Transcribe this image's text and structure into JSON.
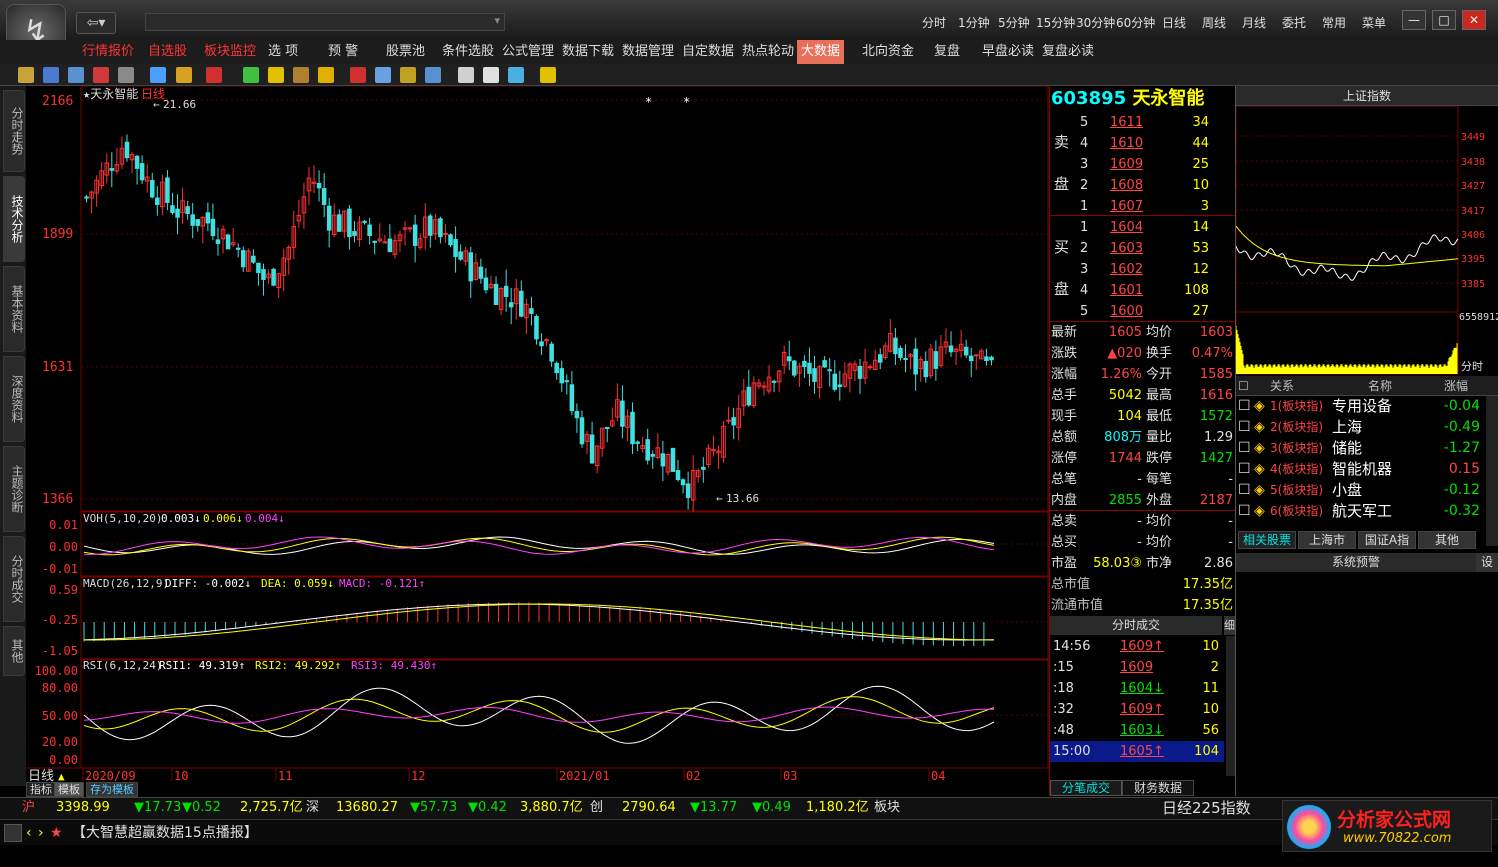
{
  "titlebar": {
    "periods": [
      "分时",
      "1分钟",
      "5分钟",
      "15分钟",
      "30分钟",
      "60分钟",
      "日线",
      "周线",
      "月线",
      "委托",
      "常用",
      "菜单"
    ]
  },
  "menu": {
    "items": [
      "行情报价",
      "自选股",
      "板块监控",
      "选 项",
      "预 警",
      "股票池",
      "条件选股",
      "公式管理",
      "数据下载",
      "数据管理",
      "自定数据",
      "热点轮动",
      "大数据",
      "北向资金",
      "复盘",
      "早盘必读",
      "复盘必读"
    ]
  },
  "left_tabs": [
    "分时走势",
    "技术分析",
    "基本资料",
    "深度资料",
    "主题诊断",
    "分时成交",
    "其他"
  ],
  "chart": {
    "name": "★天永智能",
    "period": "日线",
    "max_label": "21.66",
    "min_label": "13.66",
    "prices": [
      "2166",
      "1899",
      "1631",
      "1366"
    ],
    "vol_title": "VOH(5,10,20)",
    "vol_v1": "0.003↓",
    "vol_v2": "0.006↓",
    "vol_v3": "0.004↓",
    "vol_axis": [
      "0.01",
      "0.00",
      "-0.01"
    ],
    "macd_title": "MACD(26,12,9)",
    "diff": "DIFF: -0.002↓",
    "dea": "DEA: 0.059↓",
    "macd": "MACD: -0.121↑",
    "macd_axis": [
      "0.59",
      "-0.25",
      "-1.05"
    ],
    "rsi_title": "RSI(6,12,24)",
    "rsi1": "RSI1: 49.319↑",
    "rsi2": "RSI2: 49.292↑",
    "rsi3": "RSI3: 49.430↑",
    "rsi_axis": [
      "100.00",
      "80.00",
      "50.00",
      "20.00",
      "0.00"
    ],
    "dates": [
      "2020/09",
      "10",
      "11",
      "12",
      "2021/01",
      "02",
      "03",
      "04"
    ],
    "period_label": "日线",
    "tab_index": "指标",
    "tab_template": "模板",
    "tab_save": "存为模板"
  },
  "quote": {
    "code": "603895",
    "name": "天永智能",
    "sell_label_a": "卖",
    "sell_label_b": "盘",
    "buy_label_a": "买",
    "buy_label_b": "盘",
    "asks": [
      {
        "n": "5",
        "p": "1611",
        "v": "34"
      },
      {
        "n": "4",
        "p": "1610",
        "v": "44"
      },
      {
        "n": "3",
        "p": "1609",
        "v": "25"
      },
      {
        "n": "2",
        "p": "1608",
        "v": "10"
      },
      {
        "n": "1",
        "p": "1607",
        "v": "3"
      }
    ],
    "bids": [
      {
        "n": "1",
        "p": "1604",
        "v": "14"
      },
      {
        "n": "2",
        "p": "1603",
        "v": "53"
      },
      {
        "n": "3",
        "p": "1602",
        "v": "12"
      },
      {
        "n": "4",
        "p": "1601",
        "v": "108"
      },
      {
        "n": "5",
        "p": "1600",
        "v": "27"
      }
    ],
    "stats": [
      [
        "最新",
        "1605",
        "均价",
        "1603"
      ],
      [
        "涨跌",
        "▲020",
        "换手",
        "0.47%"
      ],
      [
        "涨幅",
        "1.26%",
        "今开",
        "1585"
      ],
      [
        "总手",
        "5042",
        "最高",
        "1616"
      ],
      [
        "现手",
        "104",
        "最低",
        "1572"
      ],
      [
        "总额",
        "808万",
        "量比",
        "1.29"
      ],
      [
        "涨停",
        "1744",
        "跌停",
        "1427"
      ],
      [
        "总笔",
        "-",
        "每笔",
        "-"
      ],
      [
        "内盘",
        "2855",
        "外盘",
        "2187"
      ],
      [
        "总卖",
        "-",
        "均价",
        "-"
      ],
      [
        "总买",
        "-",
        "均价",
        "-"
      ],
      [
        "市盈",
        "58.03③",
        "市净",
        "2.86"
      ]
    ],
    "mktcap_label": "总市值",
    "mktcap": "17.35亿",
    "float_label": "流通市值",
    "float": "17.35亿",
    "ticks_head": "分时成交",
    "ticks_btn": "细",
    "ticks": [
      [
        "14:56",
        "1609↑",
        "10"
      ],
      [
        ":15",
        "1609",
        "2"
      ],
      [
        ":18",
        "1604↓",
        "11"
      ],
      [
        ":32",
        "1609↑",
        "10"
      ],
      [
        ":48",
        "1603↓",
        "56"
      ],
      [
        "15:00",
        "1605↑",
        "104"
      ]
    ],
    "tab_deal": "分笔成交",
    "tab_fin": "财务数据"
  },
  "index_panel": {
    "title": "上证指数",
    "levels": [
      "3449",
      "3438",
      "3427",
      "3417",
      "3406",
      "3395",
      "3385"
    ],
    "vol_label": "6558912",
    "fenshi": "分时"
  },
  "related": {
    "head_rel": "关系",
    "head_name": "名称",
    "head_chg": "涨幅",
    "rows": [
      [
        "1(板块指)",
        "专用设备",
        "-0.04"
      ],
      [
        "2(板块指)",
        "上海",
        "-0.49"
      ],
      [
        "3(板块指)",
        "储能",
        "-1.27"
      ],
      [
        "4(板块指)",
        "智能机器",
        "0.15"
      ],
      [
        "5(板块指)",
        "小盘",
        "-0.12"
      ],
      [
        "6(板块指)",
        "航天军工",
        "-0.32"
      ]
    ],
    "tabs": [
      "相关股票",
      "上海市",
      "国证A指",
      "其他"
    ],
    "warn": "系统预警",
    "warn_btn": "设"
  },
  "status": {
    "sh": "沪",
    "sh_idx": "3398.99",
    "sh_chg": "▼17.73",
    "sh_pct": "▼0.52",
    "sh_amt": "2,725.7亿",
    "sz": "深",
    "sz_idx": "13680.27",
    "sz_chg": "▼57.73",
    "sz_pct": "▼0.42",
    "sz_amt": "3,880.7亿",
    "cy": "创",
    "cy_idx": "2790.64",
    "cy_chg": "▼13.77",
    "cy_pct": "▼0.49",
    "cy_amt": "1,180.2亿",
    "bk": "板块",
    "nikkei": "日经225指数"
  },
  "ticker": {
    "text": "【大智慧超赢数据15点播报】"
  },
  "watermark": {
    "title": "分析家公式网",
    "url": "www.70822.com"
  }
}
